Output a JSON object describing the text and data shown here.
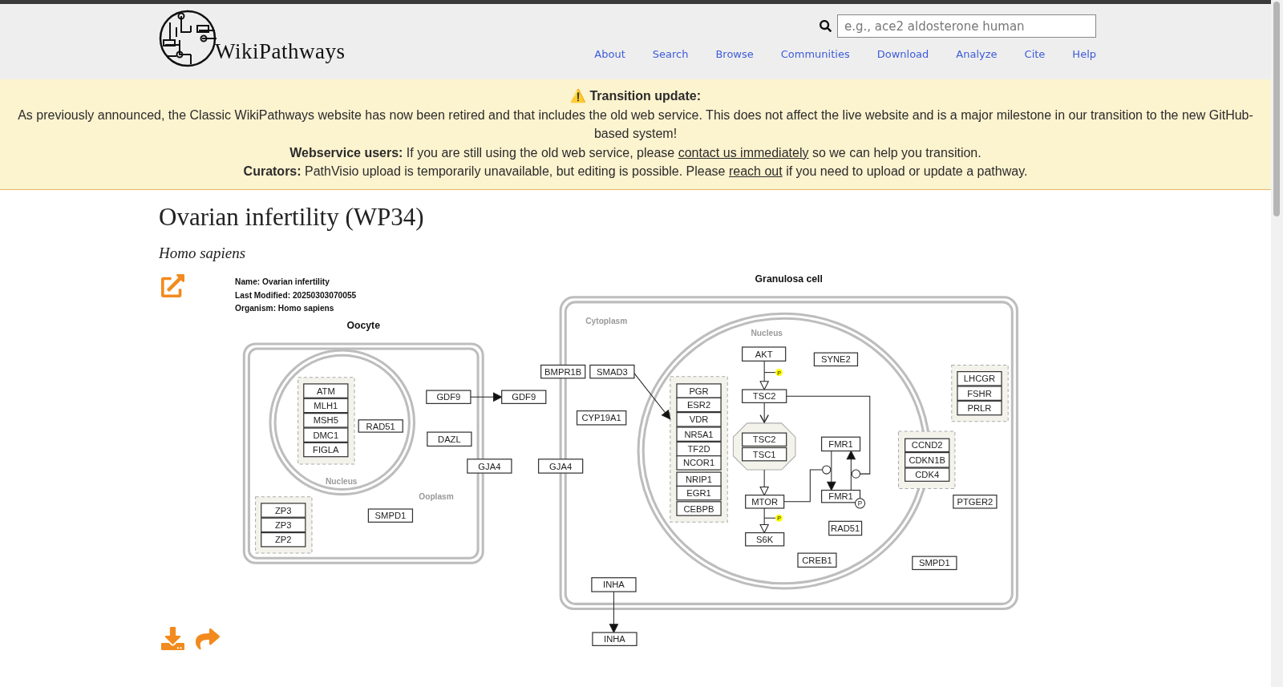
{
  "header": {
    "logo": "WikiPathways",
    "search": {
      "placeholder": "e.g., ace2 aldosterone human"
    },
    "nav": [
      "About",
      "Search",
      "Browse",
      "Communities",
      "Download",
      "Analyze",
      "Cite",
      "Help"
    ]
  },
  "banner": {
    "heading": "⚠️ Transition update:",
    "announcement": "As previously announced, the Classic WikiPathways website has now been retired and that includes the old web service. This does not affect the live website and is a major milestone in our transition to the new GitHub-based system!",
    "notes": [
      {
        "lead": "Webservice users:",
        "before": "If you are still using the old web service, please",
        "link": "contact us immediately",
        "after": "so we can help you transition."
      },
      {
        "lead": "Curators:",
        "before": "PathVisio upload is temporarily unavailable, but editing is possible. Please",
        "link": "reach out",
        "after": "if you need to upload or update a pathway."
      }
    ]
  },
  "page": {
    "title": "Ovarian infertility (WP34)",
    "organism": "Homo sapiens"
  },
  "diagram": {
    "info": [
      "Name: Ovarian infertility",
      "Last Modified: 20250303070055",
      "Organism: Homo sapiens"
    ],
    "cells": [
      {
        "title": "Oocyte",
        "labels": [
          "Nucleus",
          "Ooplasm"
        ]
      },
      {
        "title": "Granulosa cell",
        "labels": [
          "Cytoplasm",
          "Nucleus"
        ]
      }
    ],
    "genes": [
      "ATM",
      "MLH1",
      "MSH5",
      "DMC1",
      "FIGLA",
      "RAD51",
      "ZP3",
      "ZP3",
      "ZP2",
      "SMPD1",
      "GDF9",
      "GDF9",
      "DAZL",
      "GJA4",
      "GJA4",
      "BMPR1B",
      "SMAD3",
      "CYP19A1",
      "PGR",
      "ESR2",
      "VDR",
      "NR5A1",
      "TF2D",
      "NCOR1",
      "NRIP1",
      "EGR1",
      "CEBPB",
      "AKT",
      "TSC2",
      "TSC2",
      "TSC1",
      "MTOR",
      "S6K",
      "SYNE2",
      "FMR1",
      "FMR1",
      "RAD51",
      "CREB1",
      "CCND2",
      "CDKN1B",
      "CDK4",
      "LHCGR",
      "FSHR",
      "PRLR",
      "PTGER2",
      "SMPD1",
      "INHA",
      "INHA"
    ],
    "phospho": [
      "P",
      "P",
      "P"
    ]
  }
}
